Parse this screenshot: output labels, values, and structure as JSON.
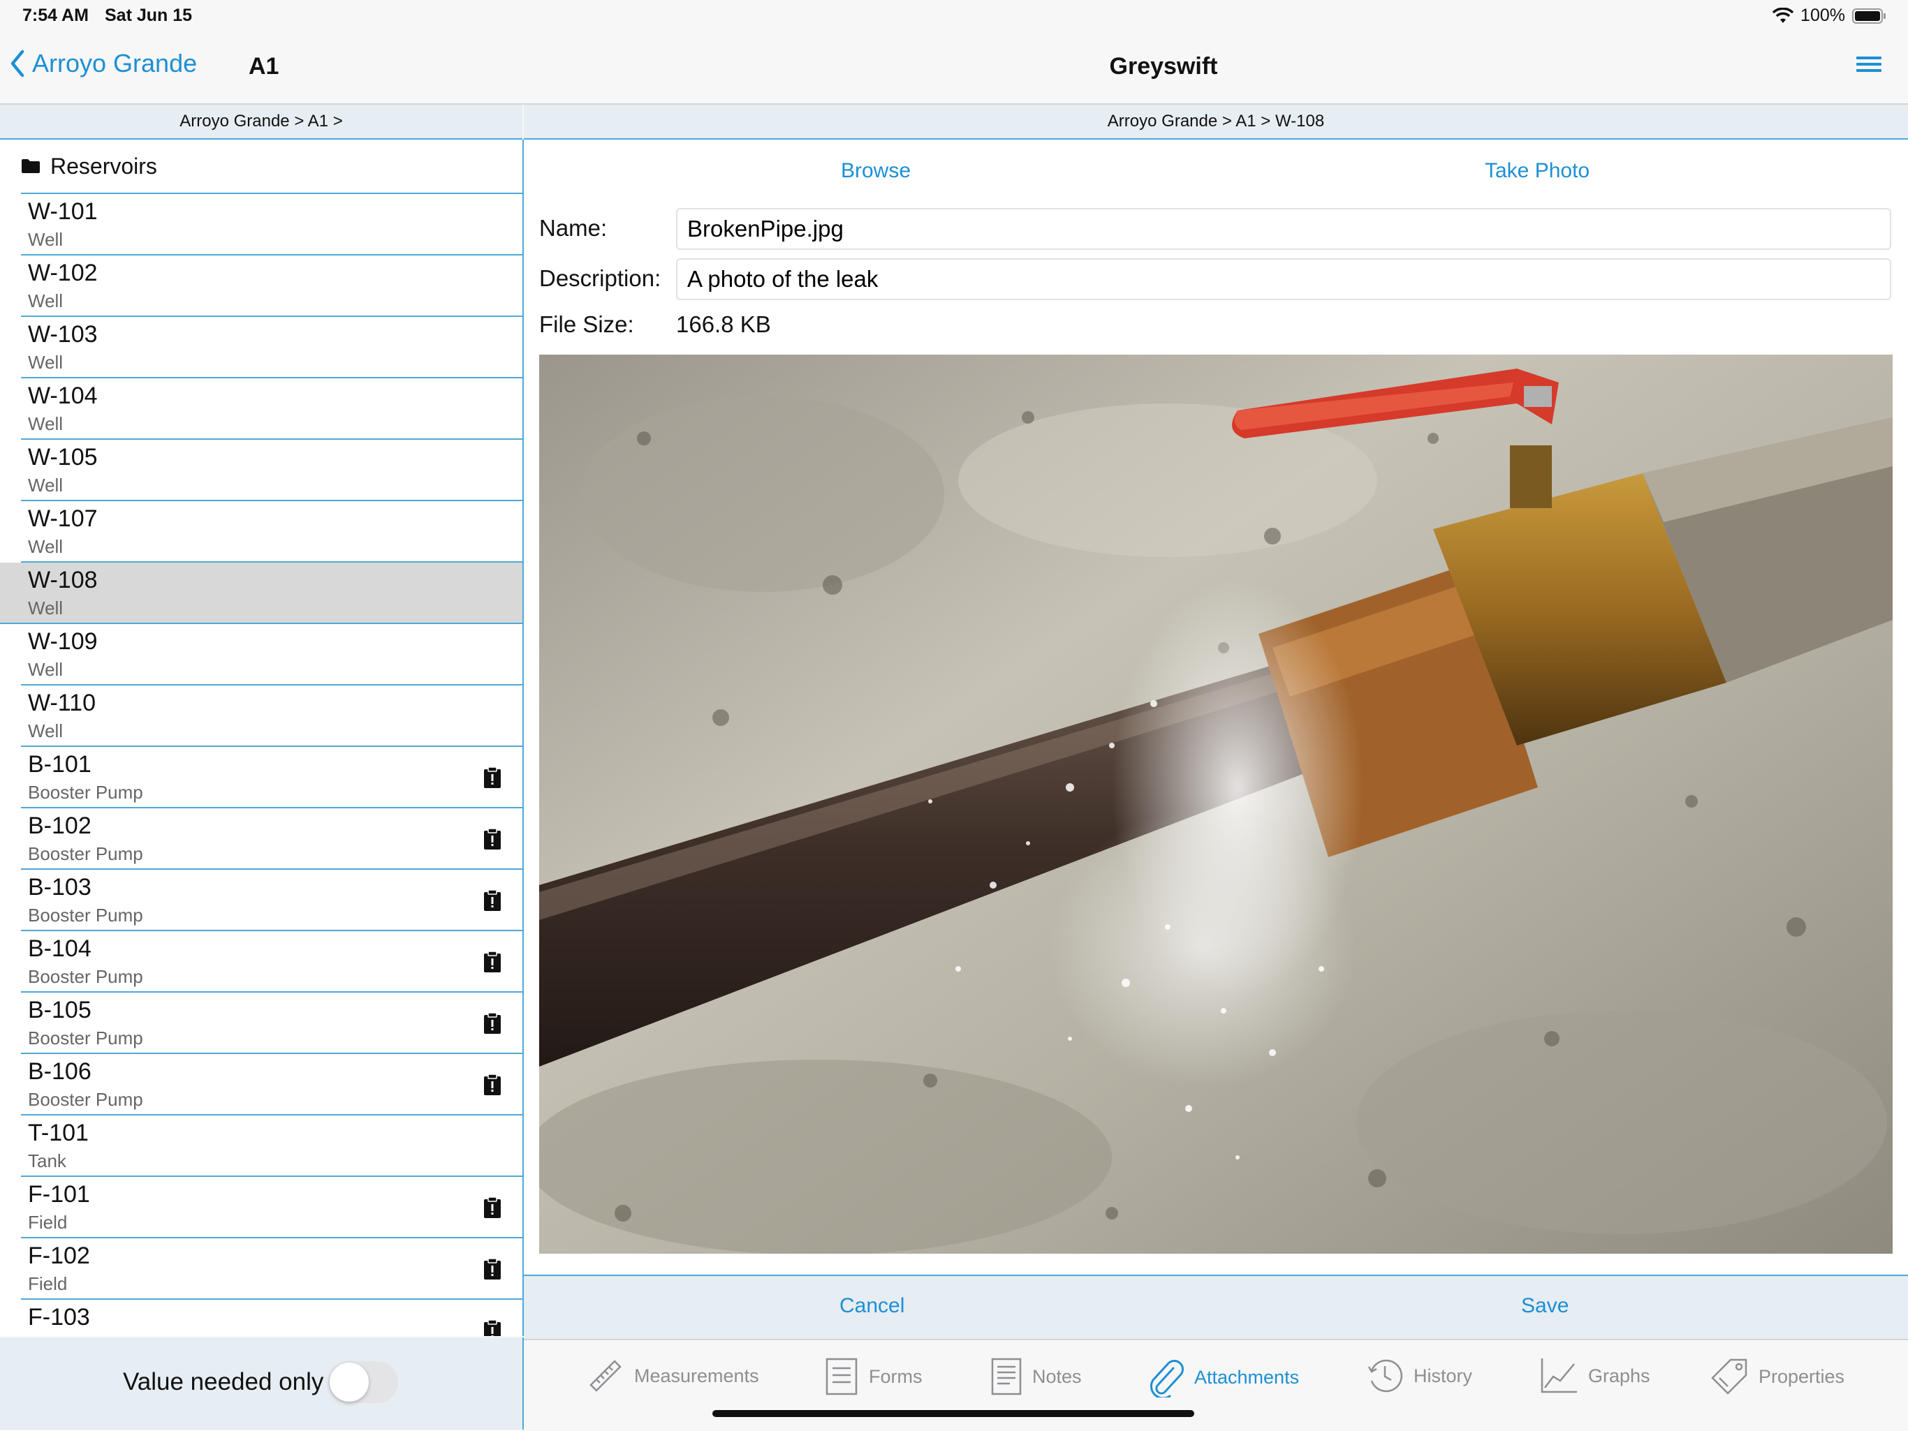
{
  "status_bar": {
    "time": "7:54 AM",
    "date": "Sat Jun 15",
    "battery": "100%"
  },
  "nav": {
    "back_label": "Arroyo Grande",
    "left_title": "A1",
    "title": "Greyswift"
  },
  "left": {
    "breadcrumb": "Arroyo Grande > A1 >",
    "folder": "Reservoirs",
    "items": [
      {
        "name": "W-101",
        "type": "Well",
        "flag": false
      },
      {
        "name": "W-102",
        "type": "Well",
        "flag": false
      },
      {
        "name": "W-103",
        "type": "Well",
        "flag": false
      },
      {
        "name": "W-104",
        "type": "Well",
        "flag": false
      },
      {
        "name": "W-105",
        "type": "Well",
        "flag": false
      },
      {
        "name": "W-107",
        "type": "Well",
        "flag": false
      },
      {
        "name": "W-108",
        "type": "Well",
        "flag": false,
        "selected": true
      },
      {
        "name": "W-109",
        "type": "Well",
        "flag": false
      },
      {
        "name": "W-110",
        "type": "Well",
        "flag": false
      },
      {
        "name": "B-101",
        "type": "Booster Pump",
        "flag": true
      },
      {
        "name": "B-102",
        "type": "Booster Pump",
        "flag": true
      },
      {
        "name": "B-103",
        "type": "Booster Pump",
        "flag": true
      },
      {
        "name": "B-104",
        "type": "Booster Pump",
        "flag": true
      },
      {
        "name": "B-105",
        "type": "Booster Pump",
        "flag": true
      },
      {
        "name": "B-106",
        "type": "Booster Pump",
        "flag": true
      },
      {
        "name": "T-101",
        "type": "Tank",
        "flag": false
      },
      {
        "name": "F-101",
        "type": "Field",
        "flag": true
      },
      {
        "name": "F-102",
        "type": "Field",
        "flag": true
      },
      {
        "name": "F-103",
        "type": "",
        "flag": true
      }
    ],
    "filter_label": "Value needed only",
    "filter_on": false
  },
  "right": {
    "breadcrumb": "Arroyo Grande > A1 > W-108",
    "browse_label": "Browse",
    "take_photo_label": "Take Photo",
    "name_label": "Name:",
    "name_value": "BrokenPipe.jpg",
    "description_label": "Description:",
    "description_value": "A photo of the leak",
    "file_size_label": "File Size:",
    "file_size_value": "166.8 KB",
    "cancel_label": "Cancel",
    "save_label": "Save"
  },
  "tabs": [
    {
      "label": "Measurements",
      "icon": "ruler-icon"
    },
    {
      "label": "Forms",
      "icon": "form-icon"
    },
    {
      "label": "Notes",
      "icon": "notes-icon"
    },
    {
      "label": "Attachments",
      "icon": "paperclip-icon",
      "active": true
    },
    {
      "label": "History",
      "icon": "clock-icon"
    },
    {
      "label": "Graphs",
      "icon": "graph-icon"
    },
    {
      "label": "Properties",
      "icon": "tag-icon"
    }
  ],
  "colors": {
    "accent": "#1d8fd4",
    "divider": "#4fa8d8",
    "bar_bg": "#e6edf3",
    "selected_row": "#d8d8d8"
  }
}
